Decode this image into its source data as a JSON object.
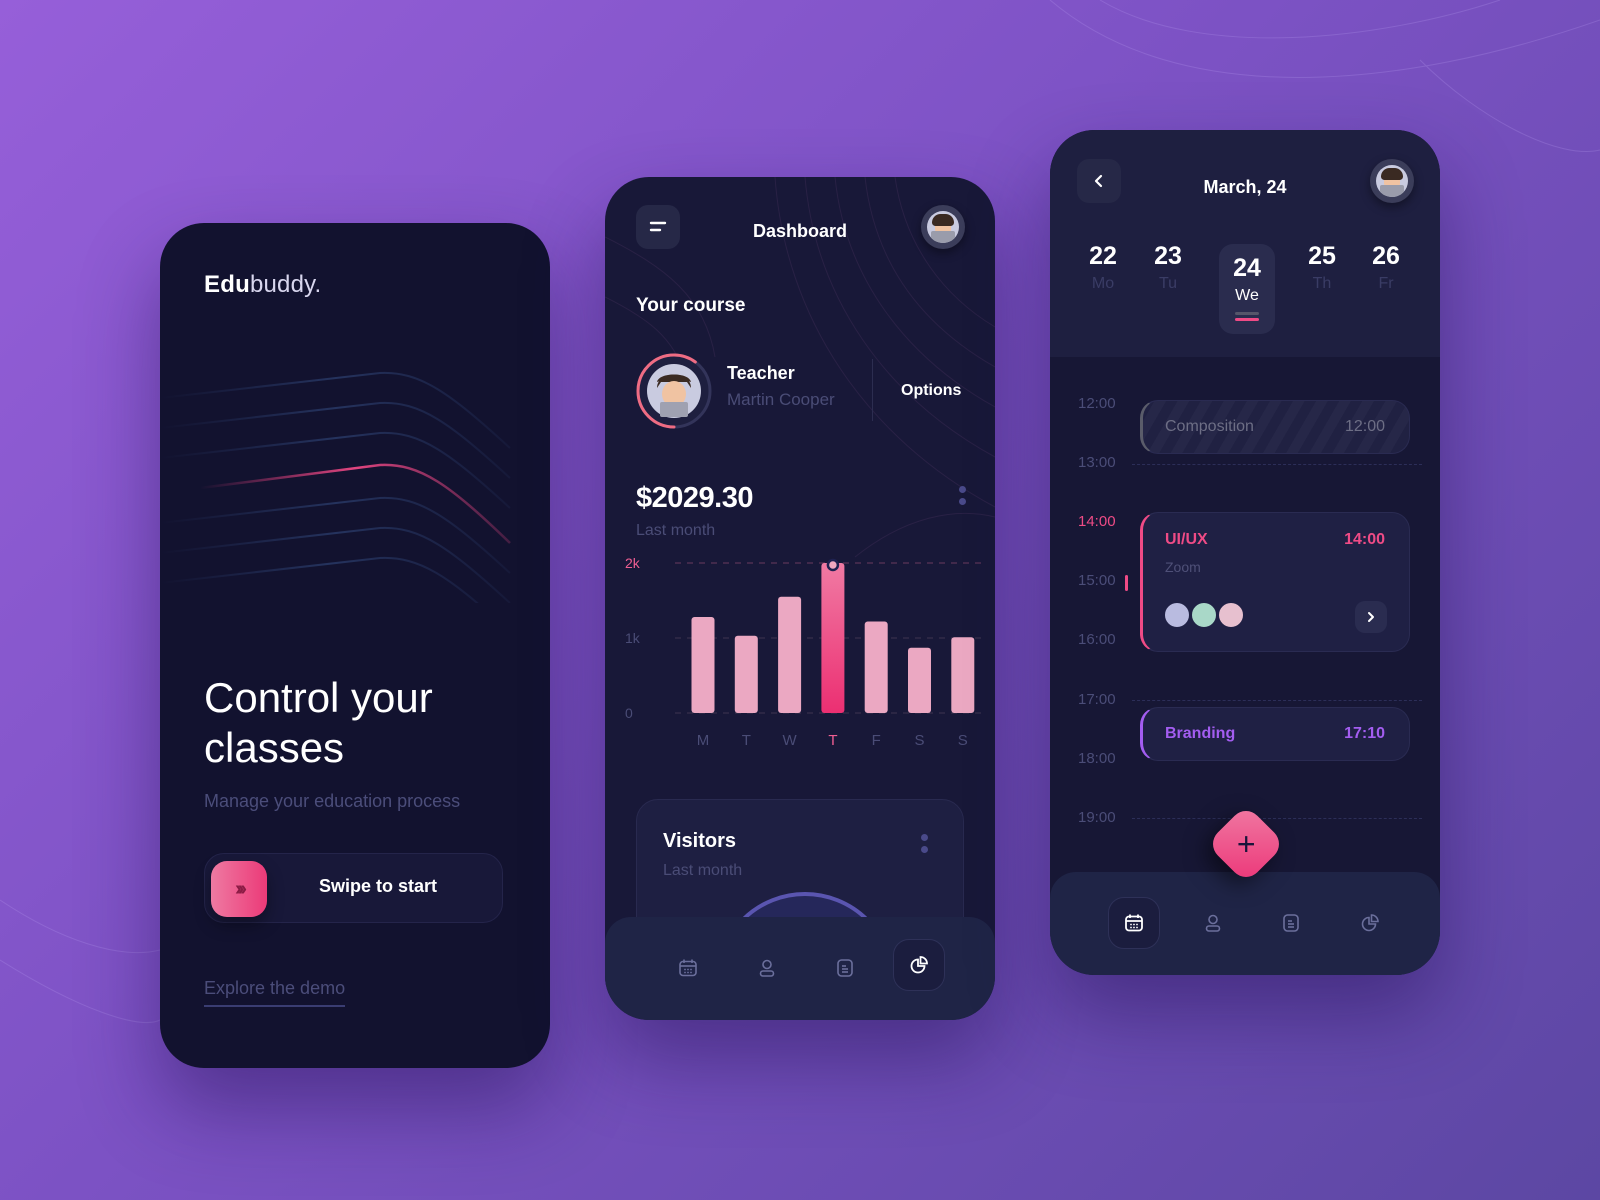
{
  "background": {
    "gradient_start": "#965fd9",
    "gradient_end": "#5c47a3"
  },
  "colors": {
    "accent_pink": "#ec3a78",
    "bar_pink_light": "#eba8c2",
    "accent_purple": "#a35df0",
    "card_dark": "#131333"
  },
  "onboarding": {
    "logo_bold": "Edu",
    "logo_light": "buddy.",
    "title": "Control your classes",
    "subtitle": "Manage your education process",
    "swipe_icon": "triple-chevron-right-icon",
    "swipe_arrows": "›››",
    "swipe_label": "Swipe to start",
    "explore_link": "Explore the demo"
  },
  "dashboard": {
    "title": "Dashboard",
    "menu_icon": "menu-icon",
    "section_title": "Your course",
    "teacher_label": "Teacher",
    "teacher_name": "Martin Cooper",
    "teacher_progress": 0.6,
    "options_label": "Options",
    "amount": "$2029.30",
    "amount_period": "Last month",
    "visitors_title": "Visitors",
    "visitors_period": "Last month",
    "nav": [
      {
        "icon": "calendar-icon",
        "active": false
      },
      {
        "icon": "user-icon",
        "active": false
      },
      {
        "icon": "document-icon",
        "active": false
      },
      {
        "icon": "pie-chart-icon",
        "active": true
      }
    ]
  },
  "chart_data": {
    "type": "bar",
    "title": "",
    "xlabel": "",
    "ylabel": "",
    "categories": [
      "M",
      "T",
      "W",
      "T",
      "F",
      "S",
      "S"
    ],
    "values": [
      1280,
      1030,
      1550,
      2000,
      1220,
      870,
      1010
    ],
    "highlight_index": 3,
    "yticks": [
      "0",
      "1k",
      "2k"
    ],
    "ytick_values": [
      0,
      1000,
      2000
    ],
    "ylim": [
      0,
      2000
    ],
    "grid": true
  },
  "schedule": {
    "title": "March, 24",
    "back_icon": "chevron-left-icon",
    "days": [
      {
        "num": "22",
        "name": "Mo",
        "active": false
      },
      {
        "num": "23",
        "name": "Tu",
        "active": false
      },
      {
        "num": "24",
        "name": "We",
        "active": true
      },
      {
        "num": "25",
        "name": "Th",
        "active": false
      },
      {
        "num": "26",
        "name": "Fr",
        "active": false
      }
    ],
    "times": [
      "12:00",
      "13:00",
      "14:00",
      "15:00",
      "16:00",
      "17:00",
      "18:00",
      "19:00"
    ],
    "current_time_index": 2,
    "events": [
      {
        "name": "Composition",
        "time": "12:00",
        "status": "past",
        "color": "#6d6e85"
      },
      {
        "name": "UI/UX",
        "time": "14:00",
        "location": "Zoom",
        "participants": 3,
        "status": "current",
        "color": "#ef4b86"
      },
      {
        "name": "Branding",
        "time": "17:10",
        "status": "upcoming",
        "color": "#a35df0"
      }
    ],
    "fab_label": "+",
    "nav": [
      {
        "icon": "calendar-icon",
        "active": true
      },
      {
        "icon": "user-icon",
        "active": false
      },
      {
        "icon": "document-icon",
        "active": false
      },
      {
        "icon": "pie-chart-icon",
        "active": false
      }
    ]
  }
}
